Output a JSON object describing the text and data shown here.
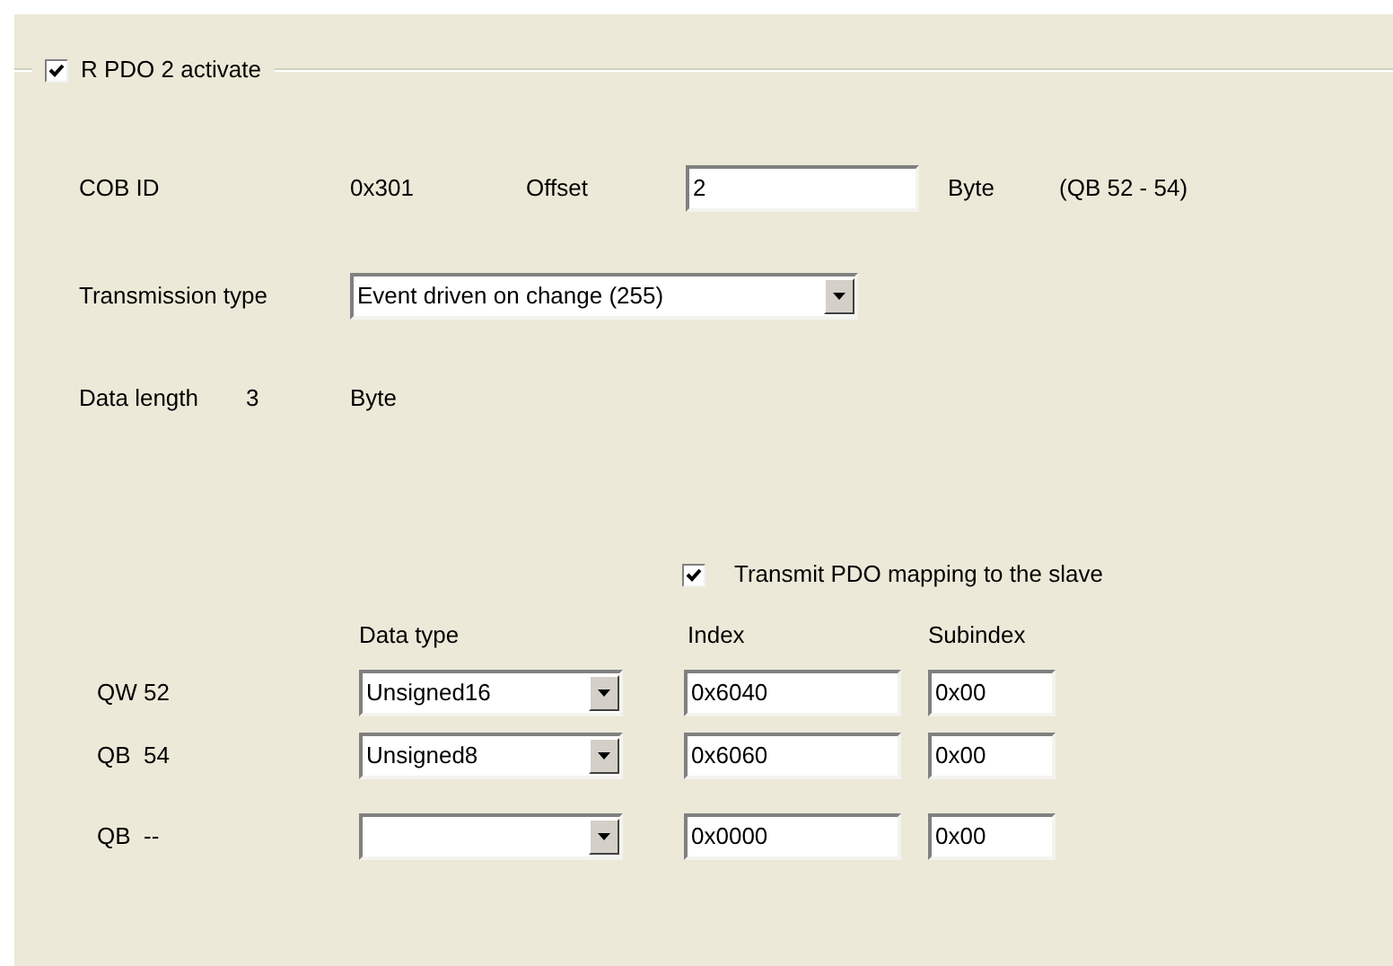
{
  "group": {
    "label": "R PDO 2 activate",
    "checked": true
  },
  "cob_id": {
    "label": "COB ID",
    "value": "0x301"
  },
  "offset": {
    "label": "Offset",
    "value": "2",
    "unit": "Byte",
    "range": "(QB 52 - 54)"
  },
  "transmission_type": {
    "label": "Transmission type",
    "value": "Event driven on change (255)"
  },
  "data_length": {
    "label": "Data length",
    "value": "3",
    "unit": "Byte"
  },
  "transmit_mapping": {
    "label": "Transmit PDO mapping to the slave",
    "checked": true
  },
  "mapping": {
    "columns": [
      "Data type",
      "Index",
      "Subindex"
    ],
    "rows": [
      {
        "address": "QW 52",
        "data_type": "Unsigned16",
        "index": "0x6040",
        "subindex": "0x00"
      },
      {
        "address": "QB  54",
        "data_type": "Unsigned8",
        "index": "0x6060",
        "subindex": "0x00"
      },
      {
        "address": "QB  --",
        "index": "0x0000",
        "subindex": "0x00"
      }
    ]
  }
}
